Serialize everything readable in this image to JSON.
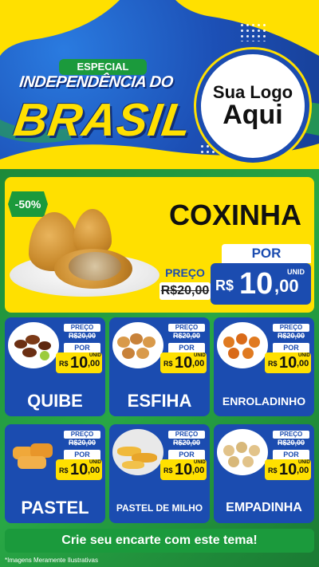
{
  "header": {
    "badge": "ESPECIAL",
    "title_line1": "INDEPENDÊNCIA DO",
    "title_line2": "BRASIL",
    "logo_line1": "Sua Logo",
    "logo_line2": "Aqui"
  },
  "hero": {
    "discount": "-50%",
    "name": "COXINHA",
    "preco_label": "PREÇO",
    "old_price": "R$20,00",
    "por_label": "POR",
    "currency": "R$",
    "price_int": "10",
    "price_dec": ",00",
    "unit": "UNID"
  },
  "cards": [
    {
      "name": "QUIBE",
      "preco_label": "PREÇO",
      "old_price": "R$20,00",
      "por_label": "POR",
      "currency": "R$",
      "price_int": "10",
      "price_dec": ",00",
      "unit": "UNID"
    },
    {
      "name": "ESFIHA",
      "preco_label": "PREÇO",
      "old_price": "R$20,00",
      "por_label": "POR",
      "currency": "R$",
      "price_int": "10",
      "price_dec": ",00",
      "unit": "UNID"
    },
    {
      "name": "ENROLADINHO",
      "preco_label": "PREÇO",
      "old_price": "R$20,00",
      "por_label": "POR",
      "currency": "R$",
      "price_int": "10",
      "price_dec": ",00",
      "unit": "UNID"
    },
    {
      "name": "PASTEL",
      "preco_label": "PREÇO",
      "old_price": "R$20,00",
      "por_label": "POR",
      "currency": "R$",
      "price_int": "10",
      "price_dec": ",00",
      "unit": "UNID"
    },
    {
      "name": "PASTEL DE MILHO",
      "preco_label": "PREÇO",
      "old_price": "R$20,00",
      "por_label": "POR",
      "currency": "R$",
      "price_int": "10",
      "price_dec": ",00",
      "unit": "UNID"
    },
    {
      "name": "EMPADINHA",
      "preco_label": "PREÇO",
      "old_price": "R$20,00",
      "por_label": "POR",
      "currency": "R$",
      "price_int": "10",
      "price_dec": ",00",
      "unit": "UNID"
    }
  ],
  "footer": {
    "cta": "Crie seu encarte com este tema!",
    "note": "*Imagens Meramente Ilustrativas"
  },
  "colors": {
    "blue": "#1b4cb0",
    "yellow": "#ffe000",
    "green": "#1b9a3c"
  }
}
